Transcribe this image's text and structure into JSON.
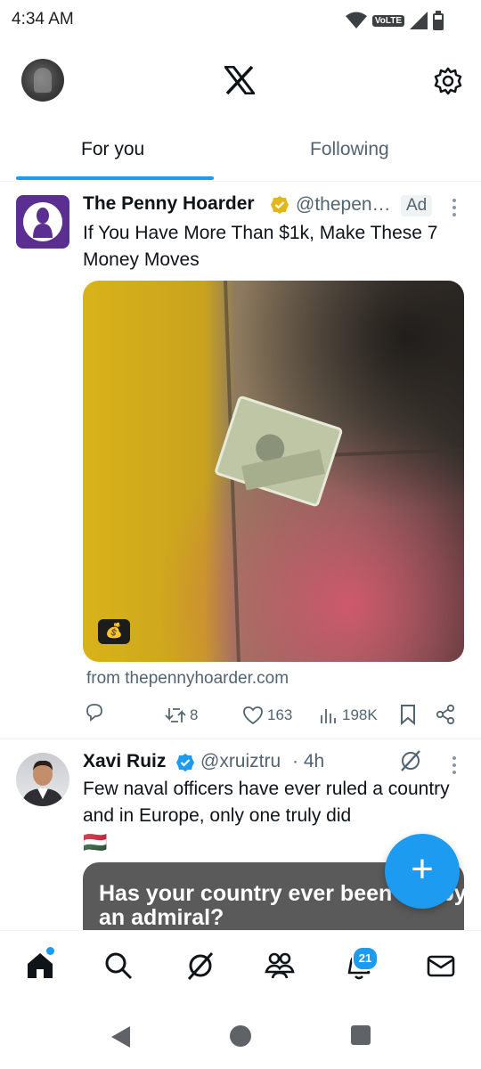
{
  "status_bar": {
    "time": "4:34 AM",
    "volte": "VoLTE"
  },
  "header": {
    "logo": "x-logo-icon",
    "settings_icon": "gear-icon"
  },
  "tabs": [
    {
      "label": "For you",
      "active": true
    },
    {
      "label": "Following",
      "active": false
    }
  ],
  "feed": [
    {
      "name": "The Penny Hoarder",
      "handle": "@thepen…",
      "badge": "Ad",
      "verified": "gold",
      "text": "If You Have More Than $1k, Make These 7 Money Moves",
      "link_source": "from thepennyhoarder.com",
      "stats": {
        "replies": "",
        "reposts": "8",
        "likes": "163",
        "views": "198K"
      },
      "media_badge_icon": "money-bag-icon"
    },
    {
      "name": "Xavi Ruiz",
      "handle": "@xruiztru",
      "time": "· 4h",
      "verified": "blue",
      "text": "Few naval officers have ever ruled a country and in Europe, only one truly did",
      "flag": "🇭🇺",
      "card_title": "Has your country ever been run by an admiral?"
    }
  ],
  "fab": {
    "label": "+"
  },
  "bottom_nav": [
    {
      "icon": "home-icon",
      "active": true
    },
    {
      "icon": "search-icon"
    },
    {
      "icon": "grok-icon"
    },
    {
      "icon": "communities-icon"
    },
    {
      "icon": "notifications-icon",
      "badge": "21"
    },
    {
      "icon": "messages-icon"
    }
  ],
  "colors": {
    "accent": "#1d9bf0",
    "text": "#0f1419",
    "muted": "#536471",
    "gold": "#e2b719"
  }
}
